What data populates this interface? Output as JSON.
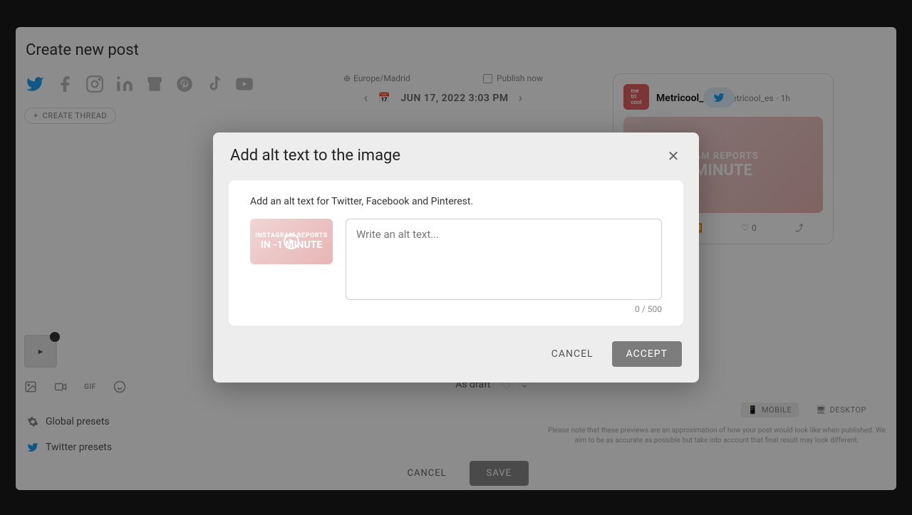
{
  "page": {
    "title": "Create new post"
  },
  "thread": {
    "create_label": "CREATE THREAD"
  },
  "schedule": {
    "timezone": "Europe/Madrid",
    "publish_now_label": "Publish now",
    "date_display": "JUN 17, 2022 3:03 PM"
  },
  "presets": {
    "global_label": "Global presets",
    "twitter_label": "Twitter presets"
  },
  "draft": {
    "label": "As draft"
  },
  "footer": {
    "cancel_label": "CANCEL",
    "save_label": "SAVE"
  },
  "media_toolbar": {
    "gif_label": "GIF"
  },
  "preview": {
    "profile_name": "Metricool_es",
    "profile_handle": "@Metricool_es",
    "time_ago": "1h",
    "avatar_text": "me\ntri\ncool",
    "image_line1": "RAM REPORTS",
    "image_line2": "MINUTE",
    "like_count": "0",
    "mode_mobile": "MOBILE",
    "mode_desktop": "DESKTOP",
    "disclaimer": "Please note that these previews are an approximation of how your post would look like when published. We aim to be as accurate as possible but take into account that final result may look different."
  },
  "modal": {
    "title": "Add alt text to the image",
    "description": "Add an alt text for Twitter, Facebook and Pinterest.",
    "placeholder": "Write an alt text...",
    "thumb_line1": "INSTAGRAM REPORTS",
    "thumb_line2": "IN -1 MINUTE",
    "char_counter": "0 / 500",
    "cancel_label": "CANCEL",
    "accept_label": "ACCEPT"
  }
}
